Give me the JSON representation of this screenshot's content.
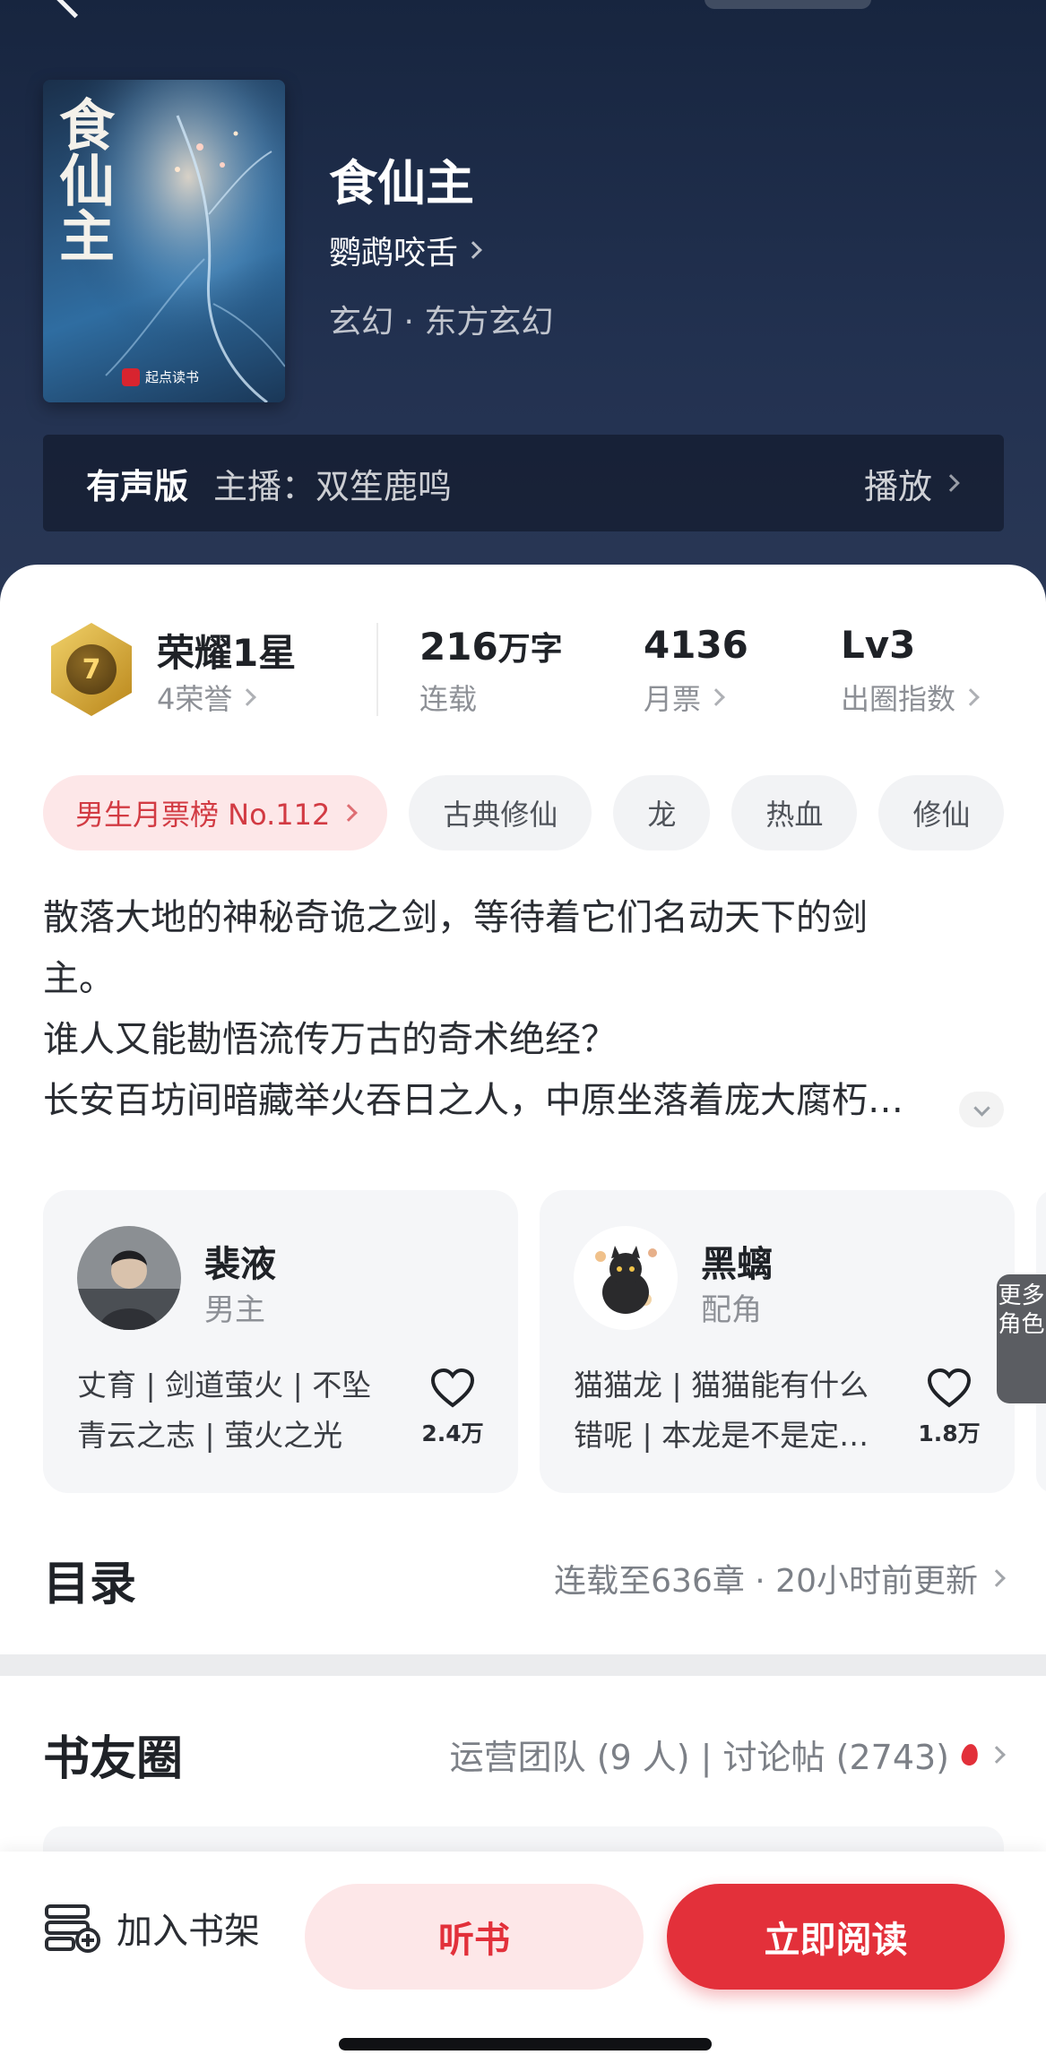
{
  "book": {
    "title": "食仙主",
    "author": "鹦鹉咬舌",
    "genre": "玄幻 · 东方玄幻",
    "cover_title": "食仙主",
    "cover_publisher": "起点读书"
  },
  "audio": {
    "badge": "有声版",
    "host": "主播：双笙鹿鸣",
    "play_label": "播放"
  },
  "stats": {
    "honor_title": "荣耀1星",
    "honor_sub": "4荣誉",
    "medal_level": "7",
    "words_value": "216",
    "words_unit": "万字",
    "words_sub": "连载",
    "votes_value": "4136",
    "votes_sub": "月票",
    "level_value": "Lv3",
    "level_sub": "出圈指数"
  },
  "tags": {
    "ranking": "男生月票榜 No.112",
    "items": [
      "古典修仙",
      "龙",
      "热血",
      "修仙"
    ]
  },
  "summary": {
    "lines": [
      "散落大地的神秘奇诡之剑，等待着它们名动天下的剑",
      "主。",
      "谁人又能勘悟流传万古的奇术绝经？",
      "长安百坊间暗藏举火吞日之人，中原坐落着庞大腐朽…"
    ]
  },
  "roles": [
    {
      "name": "裴液",
      "type": "男主",
      "desc_line1": "丈育 | 剑道萤火 | 不坠",
      "desc_line2": "青云之志 | 萤火之光",
      "likes": "2.4万"
    },
    {
      "name": "黑螭",
      "type": "配角",
      "desc_line1": "猫猫龙 | 猫猫能有什么",
      "desc_line2": "错呢 | 本龙是不是定…",
      "likes": "1.8万"
    }
  ],
  "more_roles": "更多角色",
  "toc": {
    "title": "目录",
    "meta": "连载至636章 · 20小时前更新"
  },
  "circle": {
    "title": "书友圈",
    "meta": "运营团队 (9 人) | 讨论帖 (2743)"
  },
  "bottom_bar": {
    "shelf_label": "加入书架",
    "listen_label": "听书",
    "read_label": "立即阅读"
  },
  "colors": {
    "brand_red": "#e3303a",
    "hero_bg": "#1c2a44"
  }
}
